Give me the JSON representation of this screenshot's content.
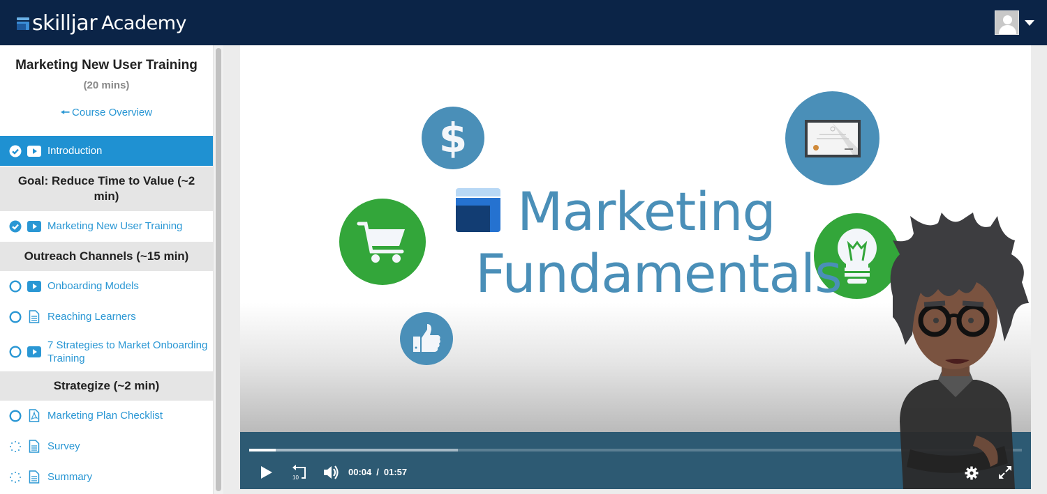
{
  "app": {
    "brand_name": "skilljar",
    "brand_suffix": "Academy"
  },
  "header": {
    "user_menu_icon": "user-avatar-icon",
    "dropdown_icon": "caret-down-icon"
  },
  "sidebar": {
    "course_title": "Marketing New User Training",
    "course_duration": "(20 mins)",
    "overview_link": "Course Overview",
    "items": [
      {
        "kind": "lesson",
        "label": "Introduction",
        "status": "complete",
        "type": "video",
        "active": true
      },
      {
        "kind": "section",
        "label": "Goal: Reduce Time to Value (~2 min)"
      },
      {
        "kind": "lesson",
        "label": "Marketing New User Training",
        "status": "complete",
        "type": "video"
      },
      {
        "kind": "section",
        "label": "Outreach Channels (~15 min)"
      },
      {
        "kind": "lesson",
        "label": "Onboarding Models",
        "status": "not-started",
        "type": "video"
      },
      {
        "kind": "lesson",
        "label": "Reaching Learners",
        "status": "not-started",
        "type": "document"
      },
      {
        "kind": "lesson",
        "label": "7 Strategies to Market Onboarding Training",
        "status": "not-started",
        "type": "video"
      },
      {
        "kind": "section",
        "label": "Strategize (~2 min)"
      },
      {
        "kind": "lesson",
        "label": "Marketing Plan Checklist",
        "status": "not-started",
        "type": "pdf"
      },
      {
        "kind": "lesson",
        "label": "Survey",
        "status": "optional",
        "type": "document"
      },
      {
        "kind": "lesson",
        "label": "Summary",
        "status": "optional",
        "type": "document"
      }
    ]
  },
  "video": {
    "title_line1": "Marketing",
    "title_line2": "Fundamentals",
    "current_time": "00:04",
    "duration": "01:57",
    "time_separator": "/",
    "played_fraction": 0.034,
    "buffered_fraction": 0.27,
    "rewind_label": "10",
    "colors": {
      "title": "#4a8fb8",
      "controls_bg": "#2d5a73",
      "circle_blue": "#4a8fb8",
      "circle_green": "#33a63a"
    }
  },
  "colors": {
    "topbar": "#0b2447",
    "accent": "#1f91d2",
    "link": "#2a97d4",
    "section_bg": "#e5e5e5"
  }
}
